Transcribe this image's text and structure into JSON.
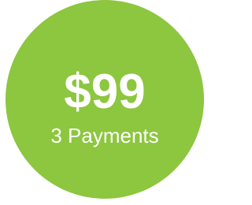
{
  "badge": {
    "price": "$99",
    "subtitle": "3 Payments",
    "colors": {
      "circle": "#8dc63f",
      "text": "#ffffff",
      "background": "#ffffff"
    }
  }
}
